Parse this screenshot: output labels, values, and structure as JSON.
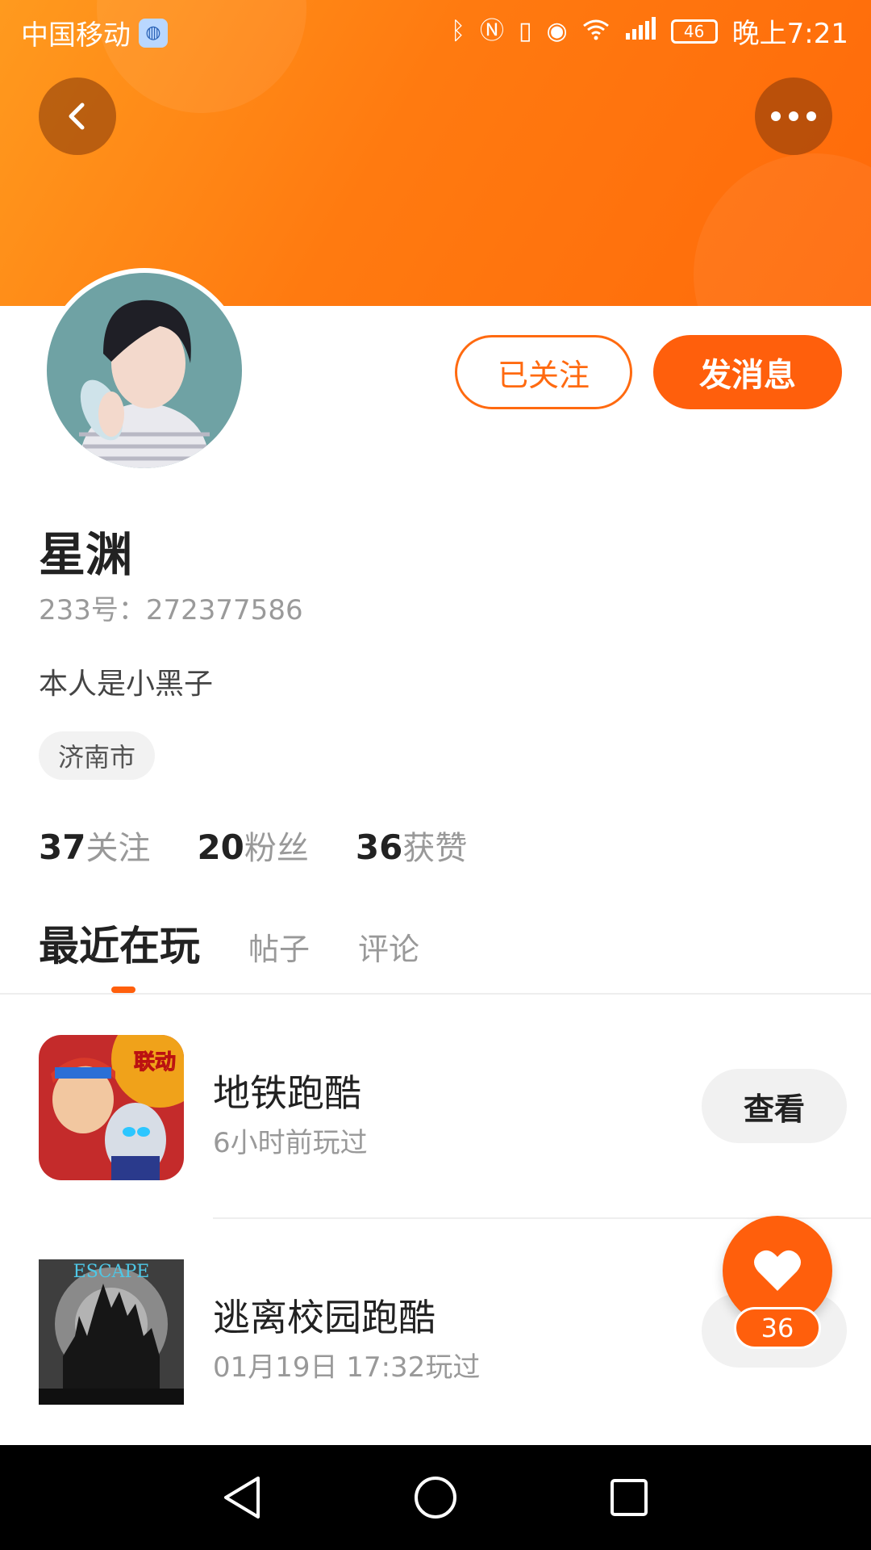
{
  "status_bar": {
    "carrier": "中国移动",
    "network": "4G",
    "battery": "46",
    "time": "晚上7:21"
  },
  "profile": {
    "name": "星渊",
    "id_text": "233号：272377586",
    "bio": "本人是小黑子",
    "location": "济南市",
    "follow_label": "已关注",
    "message_label": "发消息"
  },
  "stats": [
    {
      "value": "37",
      "label": "关注"
    },
    {
      "value": "20",
      "label": "粉丝"
    },
    {
      "value": "36",
      "label": "获赞"
    }
  ],
  "tabs": [
    {
      "label": "最近在玩",
      "active": true
    },
    {
      "label": "帖子",
      "active": false
    },
    {
      "label": "评论",
      "active": false
    }
  ],
  "games": [
    {
      "name": "地铁跑酷",
      "played": "6小时前玩过",
      "action": "查看",
      "badge": "联动"
    },
    {
      "name": "逃离校园跑酷",
      "played": "01月19日 17:32玩过",
      "action": "查看",
      "badge": "ESCAPE"
    }
  ],
  "like_fab": {
    "count": "36"
  },
  "colors": {
    "accent": "#ff5f0c",
    "banner_start": "#ff9a1e",
    "banner_end": "#ff6a0a"
  }
}
